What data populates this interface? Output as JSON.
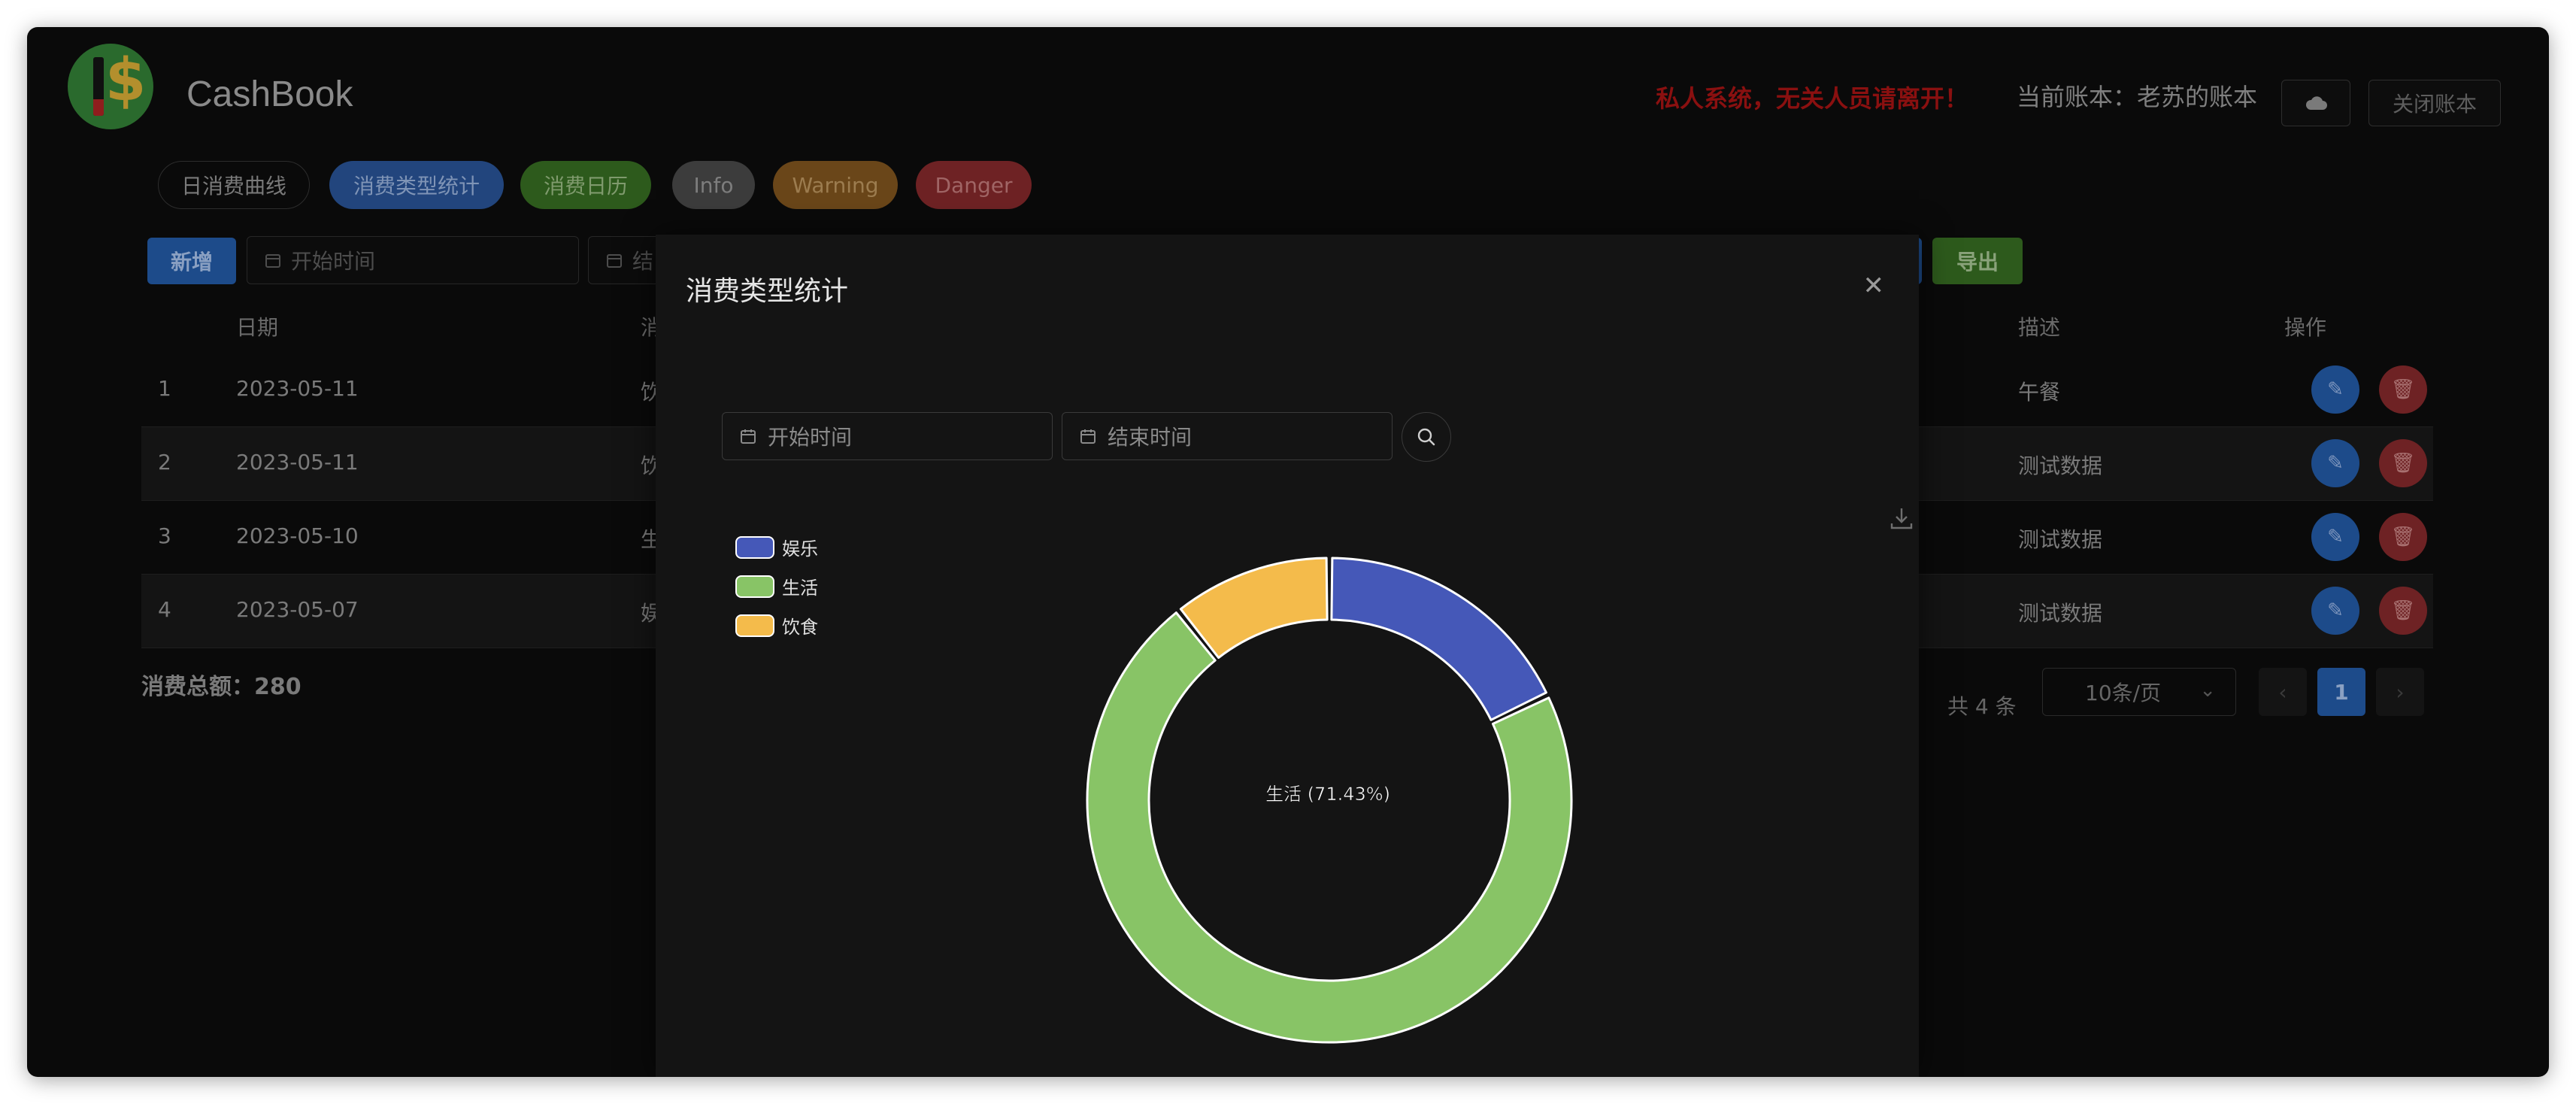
{
  "app": {
    "title": "CashBook",
    "warning": "私人系统，无关人员请离开！",
    "current_account": "当前账本：老苏的账本",
    "close_account": "关闭账本"
  },
  "tags": [
    "日消费曲线",
    "消费类型统计",
    "消费日历",
    "Info",
    "Warning",
    "Danger"
  ],
  "toolbar": {
    "add": "新增",
    "start_placeholder": "开始时间",
    "end_placeholder_partial": "结",
    "export": "导出"
  },
  "table": {
    "headers": {
      "date": "日期",
      "type_partial": "消",
      "desc": "描述",
      "ops": "操作"
    },
    "rows": [
      {
        "idx": "1",
        "date": "2023-05-11",
        "type": "饮",
        "desc": "午餐"
      },
      {
        "idx": "2",
        "date": "2023-05-11",
        "type": "饮",
        "desc": "测试数据"
      },
      {
        "idx": "3",
        "date": "2023-05-10",
        "type": "生",
        "desc": "测试数据"
      },
      {
        "idx": "4",
        "date": "2023-05-07",
        "type": "娱",
        "desc": "测试数据"
      }
    ],
    "total": "消费总额：280"
  },
  "pagination": {
    "total": "共 4 条",
    "page_size": "10条/页",
    "current": "1"
  },
  "modal": {
    "title": "消费类型统计",
    "start_placeholder": "开始时间",
    "end_placeholder": "结束时间",
    "center_label": "生活 (71.43%)"
  },
  "chart_data": {
    "type": "pie",
    "series": [
      {
        "name": "娱乐",
        "color": "#4558b8",
        "percent": 17.86
      },
      {
        "name": "生活",
        "color": "#88c466",
        "percent": 71.43
      },
      {
        "name": "饮食",
        "color": "#f4bb4b",
        "percent": 10.71
      }
    ],
    "legend": "top-left"
  },
  "icons": [
    "cloud-icon",
    "calendar-icon",
    "search-icon",
    "download-icon",
    "close-icon",
    "edit-icon",
    "delete-icon",
    "chevron-down-icon",
    "chevron-left-icon",
    "chevron-right-icon"
  ]
}
